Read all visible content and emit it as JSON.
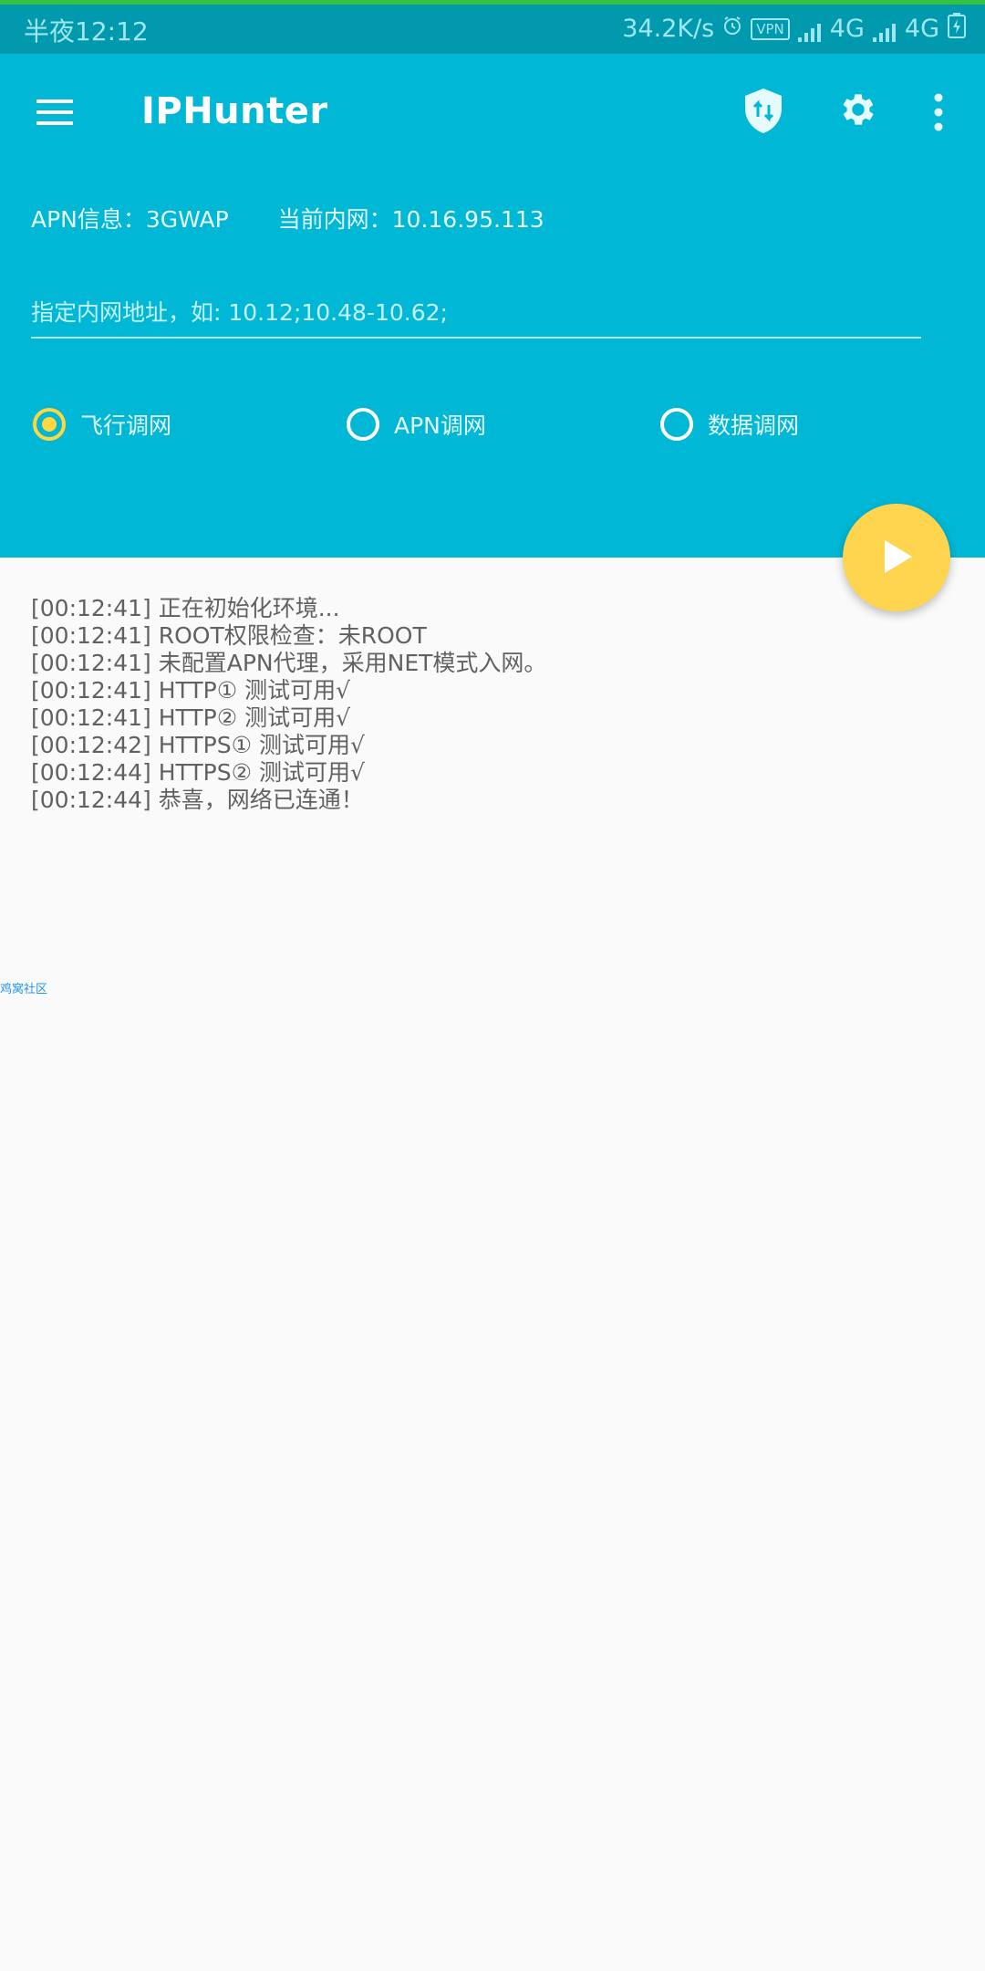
{
  "status_bar": {
    "time": "半夜12:12",
    "network_speed": "34.2K/s",
    "vpn_label": "VPN",
    "signal_1": "4G",
    "signal_2": "4G"
  },
  "app_bar": {
    "title": "IPHunter",
    "background": "#00b8d6"
  },
  "info": {
    "apn": "APN信息：3GWAP",
    "current_intranet": "当前内网：10.16.95.113"
  },
  "ip_input": {
    "placeholder": "指定内网地址，如: 10.12;10.48-10.62;",
    "value": ""
  },
  "modes": {
    "selected": "flight",
    "options": [
      {
        "id": "flight",
        "label": "飞行调网"
      },
      {
        "id": "apn",
        "label": "APN调网"
      },
      {
        "id": "data",
        "label": "数据调网"
      }
    ]
  },
  "fab": {
    "icon": "play-icon",
    "color": "#ffd54f"
  },
  "log": {
    "lines": [
      "[00:12:41] 正在初始化环境...",
      "[00:12:41] ROOT权限检查：未ROOT",
      "[00:12:41] 未配置APN代理，采用NET模式入网。",
      "[00:12:41] HTTP①   测试可用√",
      "[00:12:41] HTTP②   测试可用√",
      "[00:12:42] HTTPS① 测试可用√",
      "[00:12:44] HTTPS② 测试可用√",
      "[00:12:44] 恭喜，网络已连通！"
    ]
  },
  "watermark": "鸡窝社区"
}
